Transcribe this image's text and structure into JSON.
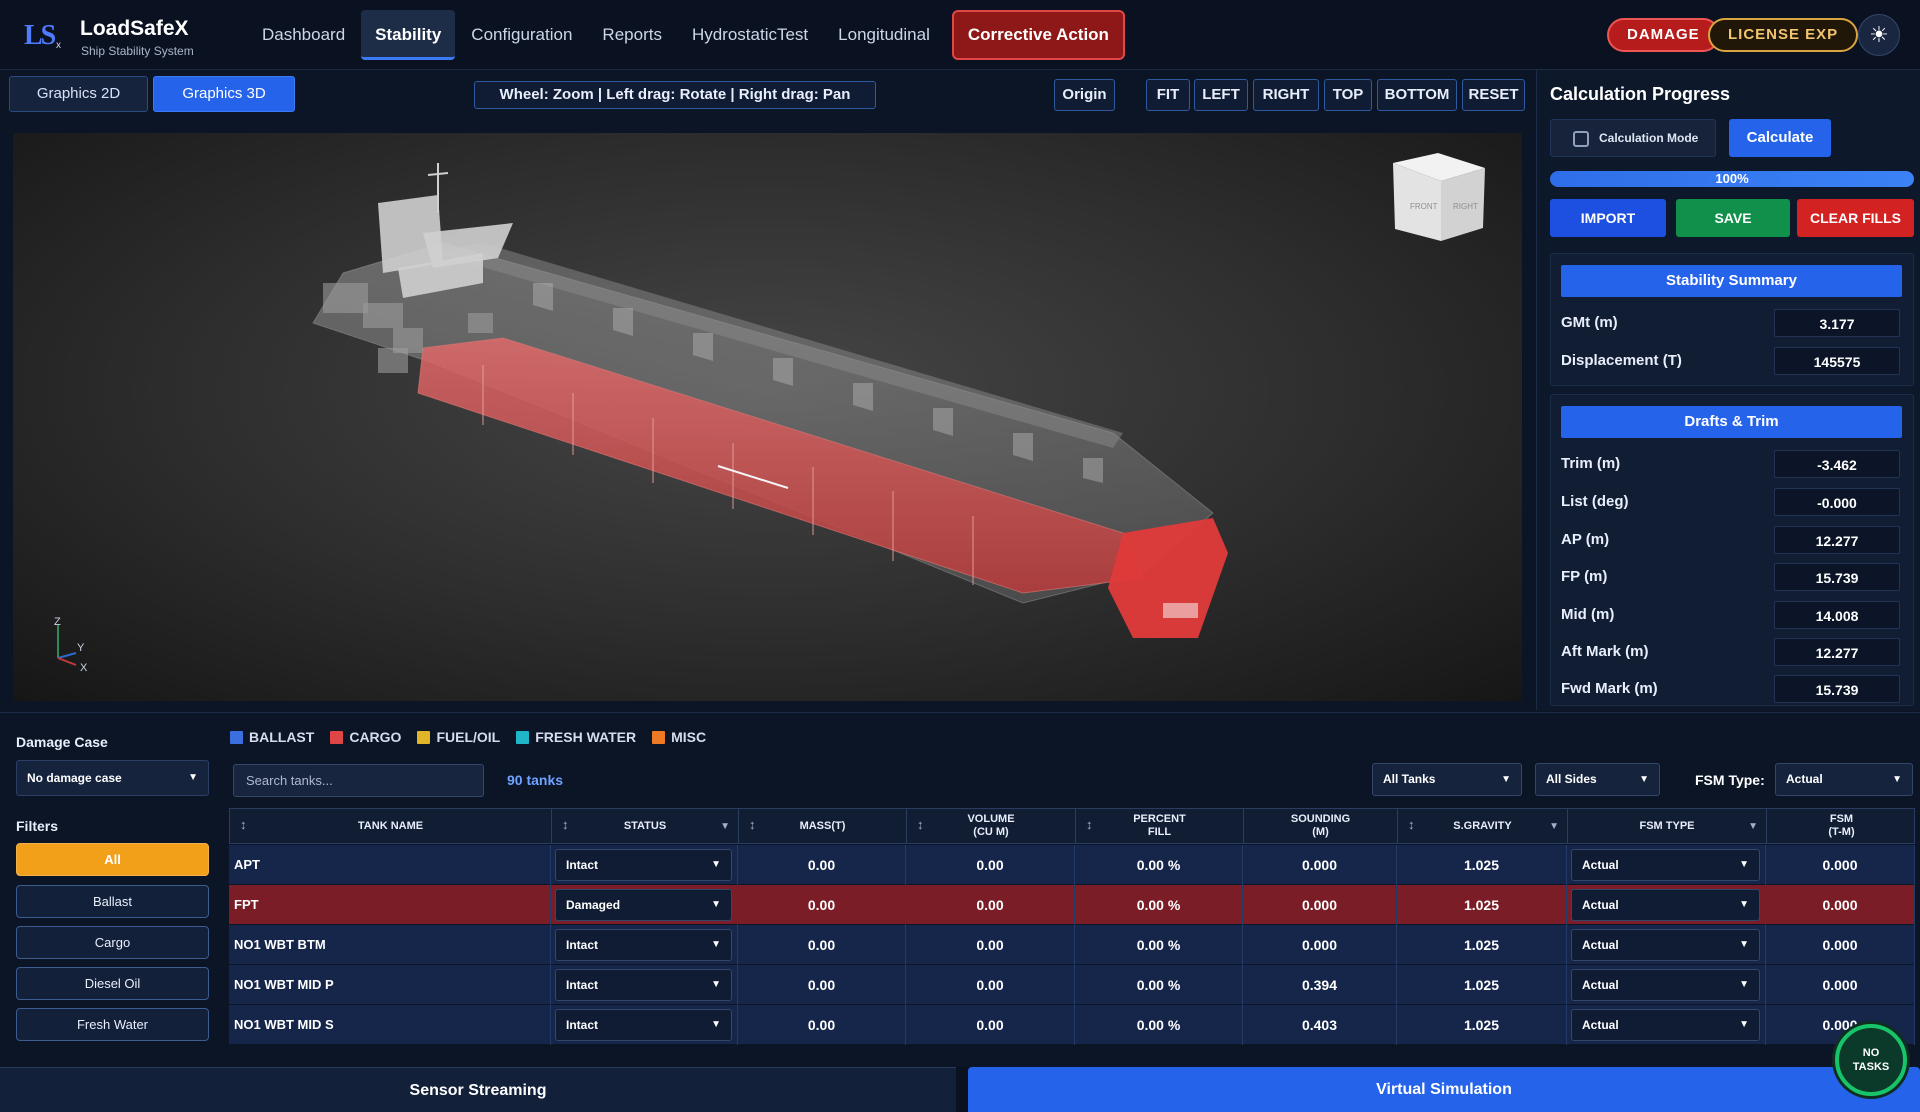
{
  "app": {
    "logo_text": "LS",
    "logo_sub": "x",
    "name": "LoadSafeX",
    "subtitle": "Ship Stability System"
  },
  "nav": {
    "items": [
      {
        "label": "Dashboard"
      },
      {
        "label": "Stability"
      },
      {
        "label": "Configuration"
      },
      {
        "label": "Reports"
      },
      {
        "label": "HydrostaticTest"
      },
      {
        "label": "Longitudinal"
      }
    ],
    "active": "Stability",
    "corrective_action": "Corrective Action"
  },
  "status": {
    "damage": "DAMAGE",
    "license": "LICENSE EXP",
    "theme_icon": "sun-icon"
  },
  "graphics": {
    "tab_2d": "Graphics 2D",
    "tab_3d": "Graphics 3D",
    "hint": "Wheel: Zoom  |  Left drag: Rotate  |  Right drag: Pan",
    "origin": "Origin",
    "views": [
      "FIT",
      "LEFT",
      "RIGHT",
      "TOP",
      "BOTTOM",
      "RESET"
    ],
    "cube_front": "FRONT",
    "cube_right": "RIGHT",
    "axes": {
      "x": "X",
      "y": "Y",
      "z": "Z"
    }
  },
  "calc": {
    "title": "Calculation Progress",
    "mode_label": "Calculation Mode",
    "mode_checked": false,
    "calculate": "Calculate",
    "progress": 100,
    "progress_label": "100%",
    "import": "IMPORT",
    "save": "SAVE",
    "clear": "CLEAR FILLS"
  },
  "stability_summary": {
    "title": "Stability Summary",
    "rows": [
      {
        "label": "GMt (m)",
        "value": "3.177"
      },
      {
        "label": "Displacement (T)",
        "value": "145575"
      }
    ]
  },
  "drafts_trim": {
    "title": "Drafts & Trim",
    "rows": [
      {
        "label": "Trim (m)",
        "value": "-3.462"
      },
      {
        "label": "List (deg)",
        "value": "-0.000"
      },
      {
        "label": "AP (m)",
        "value": "12.277"
      },
      {
        "label": "FP (m)",
        "value": "15.739"
      },
      {
        "label": "Mid (m)",
        "value": "14.008"
      },
      {
        "label": "Aft Mark (m)",
        "value": "12.277"
      },
      {
        "label": "Fwd Mark (m)",
        "value": "15.739"
      }
    ]
  },
  "damage_case": {
    "label": "Damage Case",
    "value": "No damage case"
  },
  "filters": {
    "label": "Filters",
    "items": [
      "All",
      "Ballast",
      "Cargo",
      "Diesel Oil",
      "Fresh Water"
    ],
    "active": "All"
  },
  "legend": [
    {
      "label": "BALLAST",
      "color": "#3b6fe0"
    },
    {
      "label": "CARGO",
      "color": "#e04545"
    },
    {
      "label": "FUEL/OIL",
      "color": "#e0b628"
    },
    {
      "label": "FRESH WATER",
      "color": "#1fb6c9"
    },
    {
      "label": "MISC",
      "color": "#ef7a25"
    }
  ],
  "tank_toolbar": {
    "search_placeholder": "Search tanks...",
    "count": "90 tanks",
    "tank_filter": "All Tanks",
    "side_filter": "All Sides",
    "fsm_label": "FSM Type:",
    "fsm_value": "Actual"
  },
  "table": {
    "headers": [
      "TANK NAME",
      "STATUS",
      "MASS(T)",
      "VOLUME\n(CU M)",
      "PERCENT\nFILL",
      "SOUNDING\n(M)",
      "S.GRAVITY",
      "FSM TYPE",
      "FSM\n(T-M)"
    ],
    "rows": [
      {
        "name": "APT",
        "status": "Intact",
        "mass": "0.00",
        "volume": "0.00",
        "fill": "0.00 %",
        "sounding": "0.000",
        "sg": "1.025",
        "fsm_type": "Actual",
        "fsm": "0.000"
      },
      {
        "name": "FPT",
        "status": "Damaged",
        "mass": "0.00",
        "volume": "0.00",
        "fill": "0.00 %",
        "sounding": "0.000",
        "sg": "1.025",
        "fsm_type": "Actual",
        "fsm": "0.000"
      },
      {
        "name": "NO1 WBT BTM",
        "status": "Intact",
        "mass": "0.00",
        "volume": "0.00",
        "fill": "0.00 %",
        "sounding": "0.000",
        "sg": "1.025",
        "fsm_type": "Actual",
        "fsm": "0.000"
      },
      {
        "name": "NO1 WBT MID P",
        "status": "Intact",
        "mass": "0.00",
        "volume": "0.00",
        "fill": "0.00 %",
        "sounding": "0.394",
        "sg": "1.025",
        "fsm_type": "Actual",
        "fsm": "0.000"
      },
      {
        "name": "NO1 WBT MID S",
        "status": "Intact",
        "mass": "0.00",
        "volume": "0.00",
        "fill": "0.00 %",
        "sounding": "0.403",
        "sg": "1.025",
        "fsm_type": "Actual",
        "fsm": "0.000"
      }
    ]
  },
  "bottom": {
    "sensor": "Sensor Streaming",
    "virtual": "Virtual Simulation",
    "tasks": "NO\nTASKS"
  }
}
